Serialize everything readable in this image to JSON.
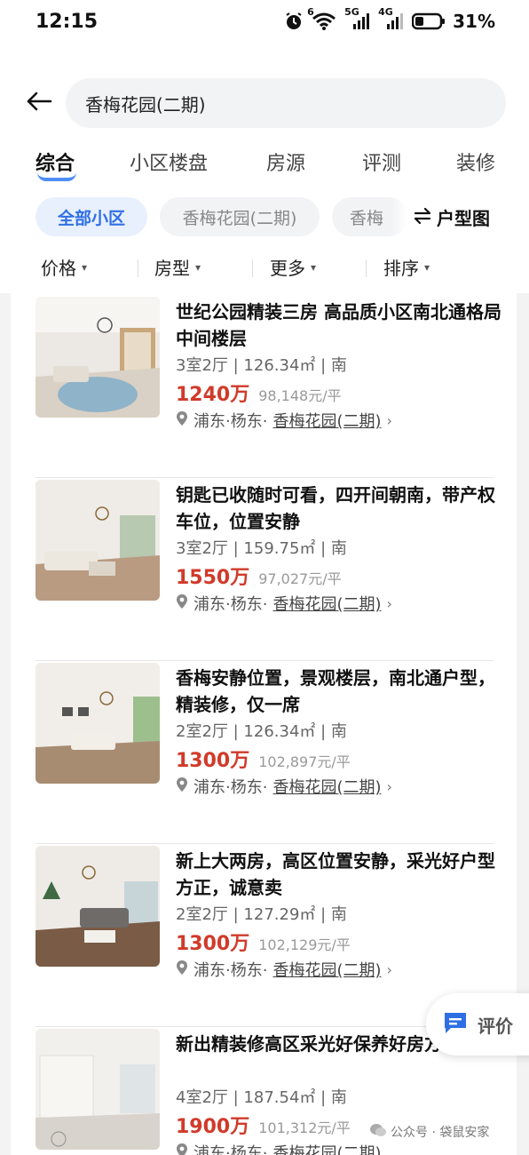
{
  "status_bar": {
    "time": "12:15",
    "battery": "31%",
    "battery_level": 0.31,
    "icons": [
      "alarm-icon",
      "wifi-icon",
      "5g-signal-icon",
      "4g-signal-icon",
      "battery-icon"
    ],
    "signal_labels": [
      "6",
      "5G",
      "4G"
    ]
  },
  "search": {
    "back_icon": "back-arrow-icon",
    "query": "香梅花园(二期)"
  },
  "tabs": [
    {
      "label": "综合",
      "active": true
    },
    {
      "label": "小区楼盘",
      "active": false
    },
    {
      "label": "房源",
      "active": false
    },
    {
      "label": "评测",
      "active": false
    },
    {
      "label": "装修",
      "active": false
    }
  ],
  "chips": [
    {
      "label": "全部小区",
      "active": true
    },
    {
      "label": "香梅花园(二期)",
      "active": false
    },
    {
      "label": "香梅",
      "active": false
    }
  ],
  "layout_button": {
    "icon": "swap-icon",
    "label": "户型图"
  },
  "filters": [
    {
      "label": "价格"
    },
    {
      "label": "房型"
    },
    {
      "label": "更多"
    },
    {
      "label": "排序"
    }
  ],
  "listings": [
    {
      "title": "世纪公园精装三房 高品质小区南北通格局中间楼层",
      "specs": "3室2厅 | 126.34㎡ | 南",
      "price": "1240万",
      "unit_price": "98,148元/平",
      "district": "浦东·杨东·",
      "community": "香梅花园(二期)"
    },
    {
      "title": "钥匙已收随时可看，四开间朝南，带产权车位，位置安静",
      "specs": "3室2厅 | 159.75㎡ | 南",
      "price": "1550万",
      "unit_price": "97,027元/平",
      "district": "浦东·杨东·",
      "community": "香梅花园(二期)"
    },
    {
      "title": "香梅安静位置，景观楼层，南北通户型，精装修，仅一席",
      "specs": "2室2厅 | 126.34㎡ | 南",
      "price": "1300万",
      "unit_price": "102,897元/平",
      "district": "浦东·杨东·",
      "community": "香梅花园(二期)"
    },
    {
      "title": "新上大两房，高区位置安静，采光好户型方正，诚意卖",
      "specs": "2室2厅 | 127.29㎡ | 南",
      "price": "1300万",
      "unit_price": "102,129元/平",
      "district": "浦东·杨东·",
      "community": "香梅花园(二期)"
    },
    {
      "title": "新出精装修高区采光好保养好房方便",
      "specs": "4室2厅 | 187.54㎡ | 南",
      "price": "1900万",
      "unit_price": "101,312元/平",
      "district": "浦东·杨东·",
      "community": "香梅花园(二期)"
    }
  ],
  "review_button": {
    "icon": "comment-icon",
    "label": "评价"
  },
  "watermark": {
    "text": "公众号 · 袋鼠安家"
  },
  "colors": {
    "accent": "#2f6fe4",
    "price": "#d13a2a"
  }
}
